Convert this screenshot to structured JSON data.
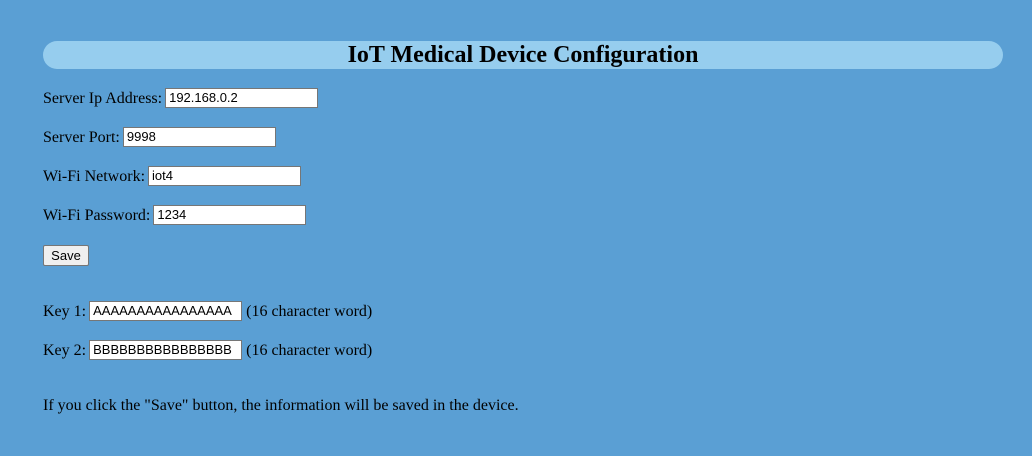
{
  "header": {
    "title": "IoT Medical Device Configuration"
  },
  "form": {
    "server_ip": {
      "label": "Server Ip Address:",
      "value": "192.168.0.2"
    },
    "server_port": {
      "label": "Server Port:",
      "value": "9998"
    },
    "wifi_network": {
      "label": "Wi-Fi Network:",
      "value": "iot4"
    },
    "wifi_password": {
      "label": "Wi-Fi Password:",
      "value": "1234"
    },
    "save_label": "Save"
  },
  "keys": {
    "key1": {
      "label": "Key 1:",
      "value": "AAAAAAAAAAAAAAAA",
      "note": "(16 character word)"
    },
    "key2": {
      "label": "Key 2:",
      "value": "BBBBBBBBBBBBBBBB",
      "note": "(16 character word)"
    }
  },
  "footer": {
    "info": "If you click the \"Save\" button, the information will be saved in the device."
  },
  "colors": {
    "background": "#5a9fd4",
    "title_bar": "#96cdee"
  }
}
